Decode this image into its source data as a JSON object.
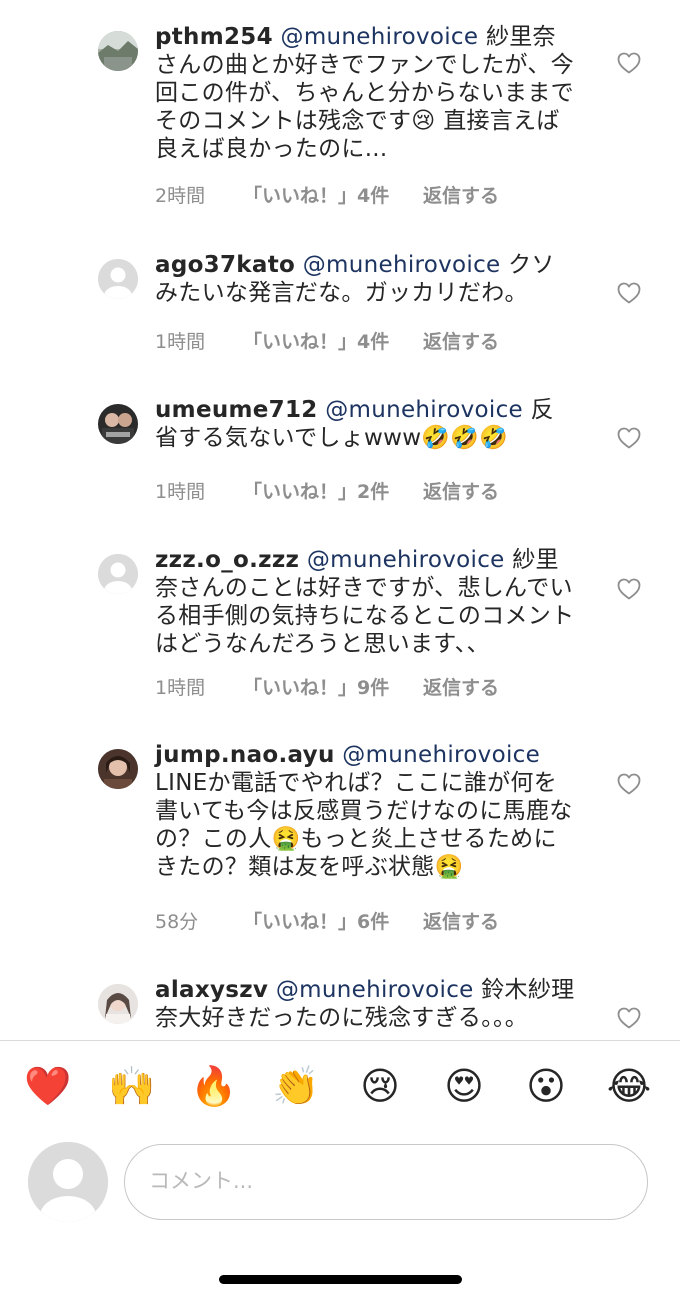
{
  "comments": [
    {
      "username": "pthm254",
      "mention": "@munehirovoice",
      "text": " 紗里奈さんの曲とか好きでファンでしたが、今回この件が、ちゃんと分からないままでそのコメントは残念です😢 直接言えば良えば良かったのに...",
      "time": "2時間",
      "likes": "「いいね！」4件",
      "reply": "返信する",
      "avatar": "landscape"
    },
    {
      "username": "ago37kato",
      "mention": "@munehirovoice",
      "text": " クソみたいな発言だな。ガッカリだわ。",
      "time": "1時間",
      "likes": "「いいね！」4件",
      "reply": "返信する",
      "avatar": "default"
    },
    {
      "username": "umeume712",
      "mention": "@munehirovoice",
      "text": " 反省する気ないでしょwww🤣🤣🤣",
      "time": "1時間",
      "likes": "「いいね！」2件",
      "reply": "返信する",
      "avatar": "photo-dark"
    },
    {
      "username": "zzz.o_o.zzz",
      "mention": "@munehirovoice",
      "text": " 紗里奈さんのことは好きですが、悲しんでいる相手側の気持ちになるとこのコメントはどうなんだろうと思います、、",
      "time": "1時間",
      "likes": "「いいね！」9件",
      "reply": "返信する",
      "avatar": "default"
    },
    {
      "username": "jump.nao.ayu",
      "mention": "@munehirovoice",
      "text": " LINEか電話でやれば？ここに誰が何を書いても今は反感買うだけなのに馬鹿なの？この人🤮もっと炎上させるためにきたの？類は友を呼ぶ状態🤮",
      "time": "58分",
      "likes": "「いいね！」6件",
      "reply": "返信する",
      "avatar": "photo-brown"
    },
    {
      "username": "alaxyszv",
      "mention": "@munehirovoice",
      "text": " 鈴木紗理奈大好きだったのに残念すぎる。。。",
      "time": "",
      "likes": "",
      "reply": "",
      "avatar": "photo-light"
    }
  ],
  "emoji_bar": [
    "❤️",
    "🙌",
    "🔥",
    "👏",
    "😢",
    "😍",
    "😮",
    "😂"
  ],
  "input": {
    "placeholder": "コメント..."
  },
  "icons": {
    "like": "heart-outline-icon",
    "default_avatar": "user-silhouette-icon"
  }
}
